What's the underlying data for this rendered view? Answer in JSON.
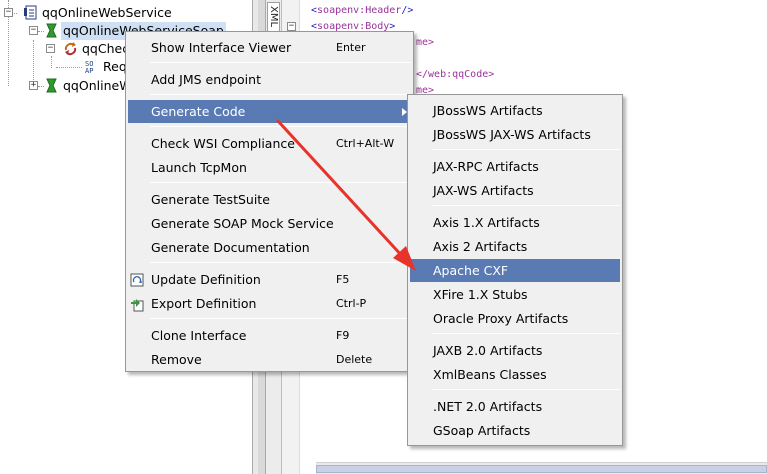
{
  "tree": {
    "service_label": "qqOnlineWebService",
    "binding1_label": "qqOnlineWebServiceSoap",
    "operation_label": "qqChec",
    "request_label": "Req",
    "binding2_label": "qqOnlineWe"
  },
  "tabstrip": {
    "tab_label": "XML"
  },
  "xml": {
    "line1_prefix": "<",
    "line1_tag": "soapenv:Header",
    "line1_suffix": "/>",
    "line2_prefix": "<",
    "line2_tag": "soapenv:Body",
    "line2_suffix": ">",
    "line3_frag": "me>",
    "line4_frag": "</web:qqCode>",
    "line5_frag": "me>"
  },
  "context_menu": {
    "items": [
      {
        "label": "Show Interface Viewer",
        "shortcut": "Enter"
      },
      {
        "label": "Add JMS endpoint",
        "shortcut": ""
      },
      {
        "label": "Generate Code",
        "shortcut": ""
      },
      {
        "label": "Check WSI Compliance",
        "shortcut": "Ctrl+Alt-W"
      },
      {
        "label": "Launch TcpMon",
        "shortcut": ""
      },
      {
        "label": "Generate TestSuite",
        "shortcut": ""
      },
      {
        "label": "Generate SOAP Mock Service",
        "shortcut": ""
      },
      {
        "label": "Generate Documentation",
        "shortcut": ""
      },
      {
        "label": "Update Definition",
        "shortcut": "F5"
      },
      {
        "label": "Export Definition",
        "shortcut": "Ctrl-P"
      },
      {
        "label": "Clone Interface",
        "shortcut": "F9"
      },
      {
        "label": "Remove",
        "shortcut": "Delete"
      }
    ]
  },
  "submenu": {
    "items": [
      {
        "label": "JBossWS Artifacts"
      },
      {
        "label": "JBossWS JAX-WS Artifacts"
      },
      {
        "label": "JAX-RPC Artifacts"
      },
      {
        "label": "JAX-WS Artifacts"
      },
      {
        "label": "Axis 1.X Artifacts"
      },
      {
        "label": "Axis 2 Artifacts"
      },
      {
        "label": "Apache CXF"
      },
      {
        "label": "XFire 1.X Stubs"
      },
      {
        "label": "Oracle Proxy Artifacts"
      },
      {
        "label": "JAXB 2.0 Artifacts"
      },
      {
        "label": "XmlBeans Classes"
      },
      {
        "label": ".NET 2.0 Artifacts"
      },
      {
        "label": "GSoap Artifacts"
      }
    ]
  },
  "colors": {
    "menu_highlight": "#5a7ab4",
    "annotation_arrow": "#e8332a",
    "tree_selection": "#cfe0f4"
  },
  "icons": {
    "service": "wsdl-document-icon",
    "binding": "soap-interface-icon",
    "operation": "operation-icon",
    "request": "soap-request-icon",
    "update": "refresh-icon",
    "export": "export-icon"
  }
}
